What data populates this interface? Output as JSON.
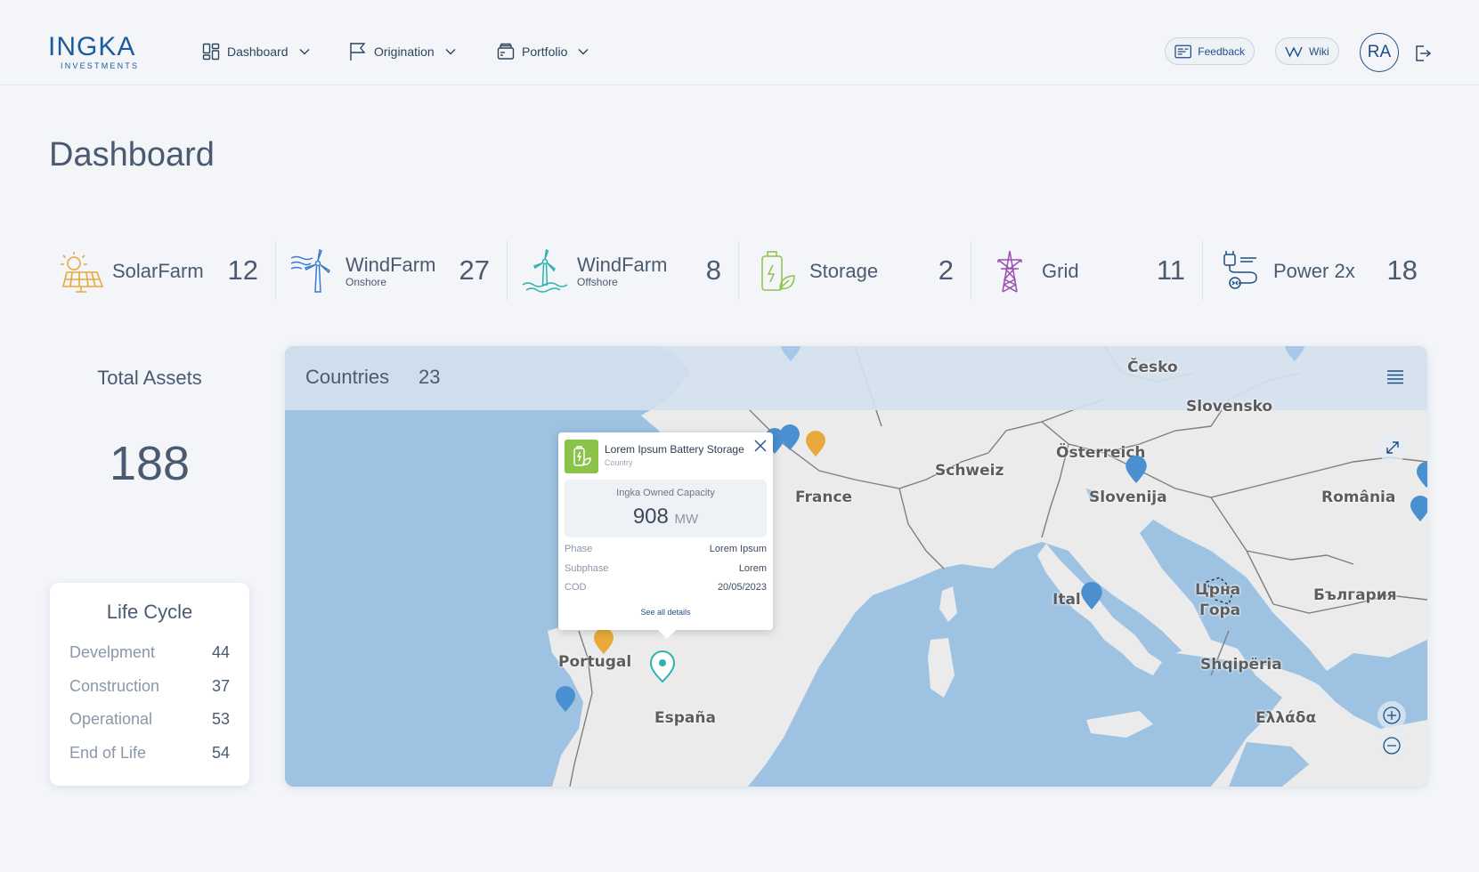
{
  "header": {
    "logo_main": "INGKA",
    "logo_sub": "INVESTMENTS",
    "nav": [
      {
        "label": "Dashboard",
        "icon": "dashboard-icon"
      },
      {
        "label": "Origination",
        "icon": "flag-icon"
      },
      {
        "label": "Portfolio",
        "icon": "portfolio-icon"
      }
    ],
    "feedback_label": "Feedback",
    "wiki_label": "Wiki",
    "avatar_initials": "RA"
  },
  "page": {
    "title": "Dashboard"
  },
  "stats": [
    {
      "label": "SolarFarm",
      "sub": "",
      "value": "12",
      "icon": "solar-panel-icon"
    },
    {
      "label": "WindFarm",
      "sub": "Onshore",
      "value": "27",
      "icon": "wind-turbine-icon"
    },
    {
      "label": "WindFarm",
      "sub": "Offshore",
      "value": "8",
      "icon": "offshore-wind-icon"
    },
    {
      "label": "Storage",
      "sub": "",
      "value": "2",
      "icon": "battery-storage-icon"
    },
    {
      "label": "Grid",
      "sub": "",
      "value": "11",
      "icon": "pylon-icon"
    },
    {
      "label": "Power 2x",
      "sub": "",
      "value": "18",
      "icon": "power-plug-icon"
    }
  ],
  "total_assets": {
    "label": "Total Assets",
    "value": "188"
  },
  "lifecycle": {
    "title": "Life Cycle",
    "rows": [
      {
        "label": "Develpment",
        "value": "44"
      },
      {
        "label": "Construction",
        "value": "37"
      },
      {
        "label": "Operational",
        "value": "53"
      },
      {
        "label": "End of Life",
        "value": "54"
      }
    ]
  },
  "map": {
    "countries_label": "Countries",
    "countries_count": "23",
    "labels": [
      "Česko",
      "Slovensko",
      "Österreich",
      "Schweiz",
      "France",
      "Slovenija",
      "România",
      "Ital",
      "Црна",
      "Гора",
      "България",
      "Shqipëria",
      "Portugal",
      "España",
      "Ελλάδα"
    ],
    "colors": {
      "blue_pin": "#4a8fd0",
      "yellow_pin": "#e8a93a",
      "teal_pin": "#2cb3b0",
      "sea": "#9ec2e2",
      "land": "#ebebeb"
    }
  },
  "popup": {
    "title": "Lorem Ipsum Battery Storage",
    "subtitle": "Country",
    "capacity_label": "Ingka Owned Capacity",
    "capacity_value": "908",
    "capacity_unit": "MW",
    "rows": [
      {
        "label": "Phase",
        "value": "Lorem Ipsum"
      },
      {
        "label": "Subphase",
        "value": "Lorem"
      },
      {
        "label": "COD",
        "value": "20/05/2023"
      }
    ],
    "link": "See all details"
  }
}
